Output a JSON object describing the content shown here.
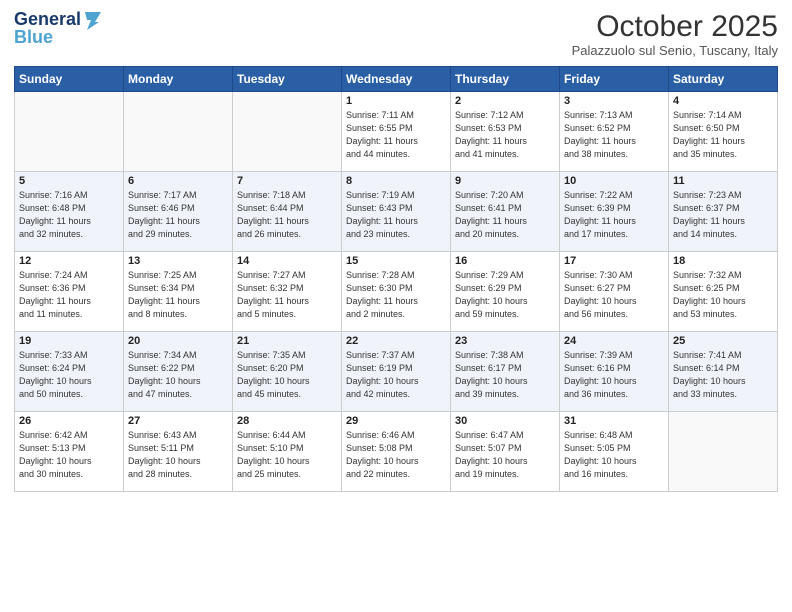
{
  "header": {
    "logo_line1": "General",
    "logo_line2": "Blue",
    "month_title": "October 2025",
    "location": "Palazzuolo sul Senio, Tuscany, Italy"
  },
  "weekdays": [
    "Sunday",
    "Monday",
    "Tuesday",
    "Wednesday",
    "Thursday",
    "Friday",
    "Saturday"
  ],
  "weeks": [
    [
      {
        "day": "",
        "info": ""
      },
      {
        "day": "",
        "info": ""
      },
      {
        "day": "",
        "info": ""
      },
      {
        "day": "1",
        "info": "Sunrise: 7:11 AM\nSunset: 6:55 PM\nDaylight: 11 hours\nand 44 minutes."
      },
      {
        "day": "2",
        "info": "Sunrise: 7:12 AM\nSunset: 6:53 PM\nDaylight: 11 hours\nand 41 minutes."
      },
      {
        "day": "3",
        "info": "Sunrise: 7:13 AM\nSunset: 6:52 PM\nDaylight: 11 hours\nand 38 minutes."
      },
      {
        "day": "4",
        "info": "Sunrise: 7:14 AM\nSunset: 6:50 PM\nDaylight: 11 hours\nand 35 minutes."
      }
    ],
    [
      {
        "day": "5",
        "info": "Sunrise: 7:16 AM\nSunset: 6:48 PM\nDaylight: 11 hours\nand 32 minutes."
      },
      {
        "day": "6",
        "info": "Sunrise: 7:17 AM\nSunset: 6:46 PM\nDaylight: 11 hours\nand 29 minutes."
      },
      {
        "day": "7",
        "info": "Sunrise: 7:18 AM\nSunset: 6:44 PM\nDaylight: 11 hours\nand 26 minutes."
      },
      {
        "day": "8",
        "info": "Sunrise: 7:19 AM\nSunset: 6:43 PM\nDaylight: 11 hours\nand 23 minutes."
      },
      {
        "day": "9",
        "info": "Sunrise: 7:20 AM\nSunset: 6:41 PM\nDaylight: 11 hours\nand 20 minutes."
      },
      {
        "day": "10",
        "info": "Sunrise: 7:22 AM\nSunset: 6:39 PM\nDaylight: 11 hours\nand 17 minutes."
      },
      {
        "day": "11",
        "info": "Sunrise: 7:23 AM\nSunset: 6:37 PM\nDaylight: 11 hours\nand 14 minutes."
      }
    ],
    [
      {
        "day": "12",
        "info": "Sunrise: 7:24 AM\nSunset: 6:36 PM\nDaylight: 11 hours\nand 11 minutes."
      },
      {
        "day": "13",
        "info": "Sunrise: 7:25 AM\nSunset: 6:34 PM\nDaylight: 11 hours\nand 8 minutes."
      },
      {
        "day": "14",
        "info": "Sunrise: 7:27 AM\nSunset: 6:32 PM\nDaylight: 11 hours\nand 5 minutes."
      },
      {
        "day": "15",
        "info": "Sunrise: 7:28 AM\nSunset: 6:30 PM\nDaylight: 11 hours\nand 2 minutes."
      },
      {
        "day": "16",
        "info": "Sunrise: 7:29 AM\nSunset: 6:29 PM\nDaylight: 10 hours\nand 59 minutes."
      },
      {
        "day": "17",
        "info": "Sunrise: 7:30 AM\nSunset: 6:27 PM\nDaylight: 10 hours\nand 56 minutes."
      },
      {
        "day": "18",
        "info": "Sunrise: 7:32 AM\nSunset: 6:25 PM\nDaylight: 10 hours\nand 53 minutes."
      }
    ],
    [
      {
        "day": "19",
        "info": "Sunrise: 7:33 AM\nSunset: 6:24 PM\nDaylight: 10 hours\nand 50 minutes."
      },
      {
        "day": "20",
        "info": "Sunrise: 7:34 AM\nSunset: 6:22 PM\nDaylight: 10 hours\nand 47 minutes."
      },
      {
        "day": "21",
        "info": "Sunrise: 7:35 AM\nSunset: 6:20 PM\nDaylight: 10 hours\nand 45 minutes."
      },
      {
        "day": "22",
        "info": "Sunrise: 7:37 AM\nSunset: 6:19 PM\nDaylight: 10 hours\nand 42 minutes."
      },
      {
        "day": "23",
        "info": "Sunrise: 7:38 AM\nSunset: 6:17 PM\nDaylight: 10 hours\nand 39 minutes."
      },
      {
        "day": "24",
        "info": "Sunrise: 7:39 AM\nSunset: 6:16 PM\nDaylight: 10 hours\nand 36 minutes."
      },
      {
        "day": "25",
        "info": "Sunrise: 7:41 AM\nSunset: 6:14 PM\nDaylight: 10 hours\nand 33 minutes."
      }
    ],
    [
      {
        "day": "26",
        "info": "Sunrise: 6:42 AM\nSunset: 5:13 PM\nDaylight: 10 hours\nand 30 minutes."
      },
      {
        "day": "27",
        "info": "Sunrise: 6:43 AM\nSunset: 5:11 PM\nDaylight: 10 hours\nand 28 minutes."
      },
      {
        "day": "28",
        "info": "Sunrise: 6:44 AM\nSunset: 5:10 PM\nDaylight: 10 hours\nand 25 minutes."
      },
      {
        "day": "29",
        "info": "Sunrise: 6:46 AM\nSunset: 5:08 PM\nDaylight: 10 hours\nand 22 minutes."
      },
      {
        "day": "30",
        "info": "Sunrise: 6:47 AM\nSunset: 5:07 PM\nDaylight: 10 hours\nand 19 minutes."
      },
      {
        "day": "31",
        "info": "Sunrise: 6:48 AM\nSunset: 5:05 PM\nDaylight: 10 hours\nand 16 minutes."
      },
      {
        "day": "",
        "info": ""
      }
    ]
  ]
}
